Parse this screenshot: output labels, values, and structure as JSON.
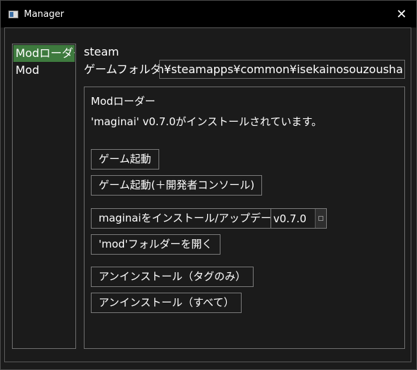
{
  "window": {
    "title": "Manager",
    "close_glyph": "✕"
  },
  "sidebar": {
    "items": [
      {
        "label": "Modローダー"
      },
      {
        "label": "Mod"
      }
    ]
  },
  "main": {
    "platform": "steam",
    "game_folder_label": "ゲームフォルダ：",
    "game_folder_value": "team¥steamapps¥common¥isekainosouzousha"
  },
  "mod_loader": {
    "heading": "Modローダー",
    "status": "'maginai' v0.7.0がインストールされています。",
    "launch_button": "ゲーム起動",
    "launch_console_button": "ゲーム起動(＋開発者コンソール)",
    "install_update_button": "maginaiをインストール/アップデート",
    "version_selected": "v0.7.0",
    "open_mod_folder_button": "'mod'フォルダーを開く",
    "uninstall_tags_button": "アンインストール（タグのみ）",
    "uninstall_all_button": "アンインストール（すべて）"
  },
  "colors": {
    "selected_item": "#3e7a3e",
    "background": "#1b1b1b",
    "titlebar": "#000000",
    "border": "#6e6e6e",
    "text": "#ffffff"
  },
  "icons": [
    "app-window-icon",
    "close-icon",
    "spin-arrows-icon"
  ]
}
